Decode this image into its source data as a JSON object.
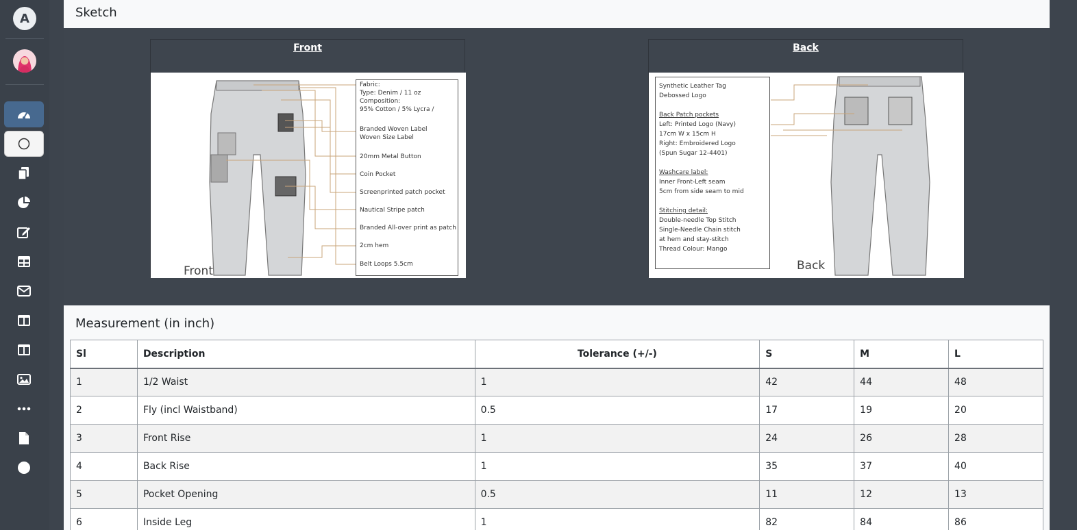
{
  "sketch": {
    "title": "Sketch",
    "front": {
      "label": "Front",
      "view_label": "Front",
      "spec_lines": [
        "Fabric:",
        "Type: Denim / 11 oz",
        "Composition:",
        "95% Cotton / 5% Lycra /",
        "Branded Woven Label",
        "Woven Size Label",
        "20mm Metal Button",
        "Coin Pocket",
        "Screenprinted patch pocket",
        "Nautical Stripe patch",
        "Branded All-over print as patch",
        "2cm hem",
        "Belt Loops 5.5cm"
      ]
    },
    "back": {
      "label": "Back",
      "view_label": "Back",
      "spec_lines": [
        "Synthetic Leather Tag",
        "Debossed Logo",
        "Back Patch pockets",
        "Left: Printed Logo (Navy)",
        "17cm W x 15cm H",
        "Right: Embroidered Logo",
        "(Spun Sugar 12-4401)",
        "Washcare label:",
        "Inner Front-Left seam",
        "5cm from side seam to mid",
        "Stitching detail:",
        "Double-needle Top Stitch",
        "Single-Needle Chain stitch",
        "at hem and stay-stitch",
        "Thread Colour: Mango"
      ]
    }
  },
  "measurement": {
    "title": "Measurement (in inch)",
    "columns": [
      "Sl",
      "Description",
      "Tolerance (+/-)",
      "S",
      "M",
      "L"
    ],
    "rows": [
      [
        "1",
        "1/2 Waist",
        "1",
        "42",
        "44",
        "48"
      ],
      [
        "2",
        "Fly (incl Waistband)",
        "0.5",
        "17",
        "19",
        "20"
      ],
      [
        "3",
        "Front Rise",
        "1",
        "24",
        "26",
        "28"
      ],
      [
        "4",
        "Back Rise",
        "1",
        "35",
        "37",
        "40"
      ],
      [
        "5",
        "Pocket Opening",
        "0.5",
        "11",
        "12",
        "13"
      ],
      [
        "6",
        "Inside Leg",
        "1",
        "82",
        "84",
        "86"
      ]
    ]
  },
  "sidebar": {
    "logo_letter": "A",
    "icons": [
      "dashboard-icon",
      "circle-outline-icon",
      "copy-icon",
      "pie-chart-icon",
      "edit-icon",
      "table-icon",
      "envelope-icon",
      "columns-icon",
      "columns-icon",
      "image-icon",
      "more-icon",
      "file-icon",
      "circle-icon"
    ]
  },
  "colors": {
    "sidebar_bg": "#3a414a",
    "active_nav": "#47698f",
    "sketch_bg": "#3e454e",
    "header_bg": "#f8f9fa"
  }
}
